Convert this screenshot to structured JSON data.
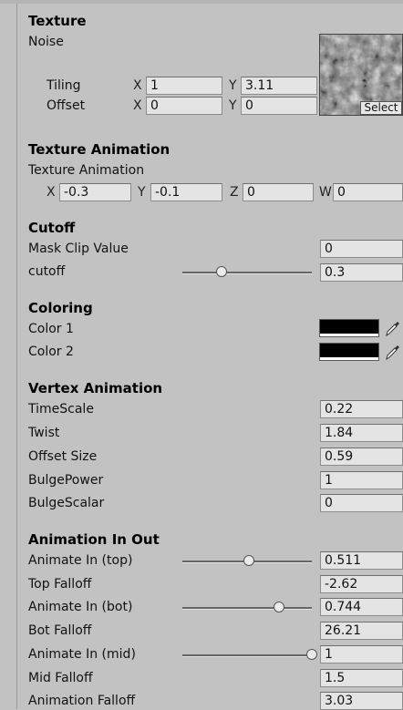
{
  "texture": {
    "header": "Texture",
    "name": "Noise",
    "tiling_label": "Tiling",
    "offset_label": "Offset",
    "tiling_x": "1",
    "tiling_y": "3.11",
    "offset_x": "0",
    "offset_y": "0",
    "select_label": "Select"
  },
  "axes": {
    "x": "X",
    "y": "Y",
    "z": "Z",
    "w": "W"
  },
  "texture_animation": {
    "header": "Texture Animation",
    "label": "Texture Animation",
    "x": "-0.3",
    "y": "-0.1",
    "z": "0",
    "w": "0"
  },
  "cutoff": {
    "header": "Cutoff",
    "mask_clip_label": "Mask Clip Value",
    "mask_clip_value": "0",
    "cutoff_label": "cutoff",
    "cutoff_value": "0.3",
    "cutoff_slider": 0.3
  },
  "coloring": {
    "header": "Coloring",
    "color1_label": "Color 1",
    "color2_label": "Color 2",
    "color1": "#000000",
    "color2": "#000000"
  },
  "vertex_animation": {
    "header": "Vertex Animation",
    "rows": [
      {
        "label": "TimeScale",
        "value": "0.22"
      },
      {
        "label": "Twist",
        "value": "1.84"
      },
      {
        "label": "Offset Size",
        "value": "0.59"
      },
      {
        "label": "BulgePower",
        "value": "1"
      },
      {
        "label": "BulgeScalar",
        "value": "0"
      }
    ]
  },
  "animation_in_out": {
    "header": "Animation In Out",
    "animate_in_top_label": "Animate In (top)",
    "animate_in_top_value": "0.511",
    "animate_in_top_slider": 0.511,
    "top_falloff_label": "Top Falloff",
    "top_falloff_value": "-2.62",
    "animate_in_bot_label": "Animate In (bot)",
    "animate_in_bot_value": "0.744",
    "animate_in_bot_slider": 0.744,
    "bot_falloff_label": "Bot Falloff",
    "bot_falloff_value": "26.21",
    "animate_in_mid_label": "Animate In (mid)",
    "animate_in_mid_value": "1",
    "animate_in_mid_slider": 1,
    "mid_falloff_label": "Mid Falloff",
    "mid_falloff_value": "1.5",
    "animation_falloff_label": "Animation Falloff",
    "animation_falloff_value": "3.03"
  }
}
